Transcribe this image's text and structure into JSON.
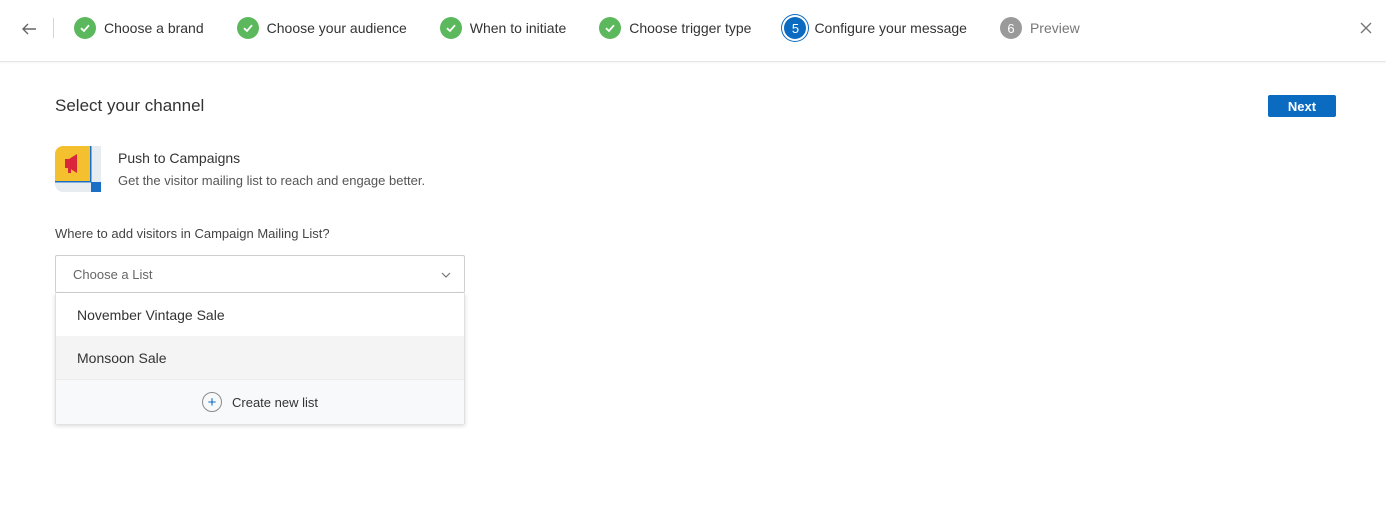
{
  "header": {
    "steps": [
      {
        "label": "Choose a brand",
        "status": "done"
      },
      {
        "label": "Choose your audience",
        "status": "done"
      },
      {
        "label": "When to initiate",
        "status": "done"
      },
      {
        "label": "Choose trigger type",
        "status": "done"
      },
      {
        "number": "5",
        "label": "Configure your message",
        "status": "active"
      },
      {
        "number": "6",
        "label": "Preview",
        "status": "pending"
      }
    ]
  },
  "main": {
    "title": "Select your channel",
    "next_label": "Next",
    "channel": {
      "title": "Push to Campaigns",
      "description": "Get the visitor mailing list to reach and engage better."
    },
    "field_label": "Where to add visitors in Campaign Mailing List?",
    "select": {
      "placeholder": "Choose a List",
      "options": [
        "November Vintage Sale",
        "Monsoon Sale"
      ],
      "create_label": "Create new list"
    }
  },
  "colors": {
    "accent": "#0a6bc1",
    "done": "#5cb85c",
    "pending": "#9a9a9a"
  }
}
